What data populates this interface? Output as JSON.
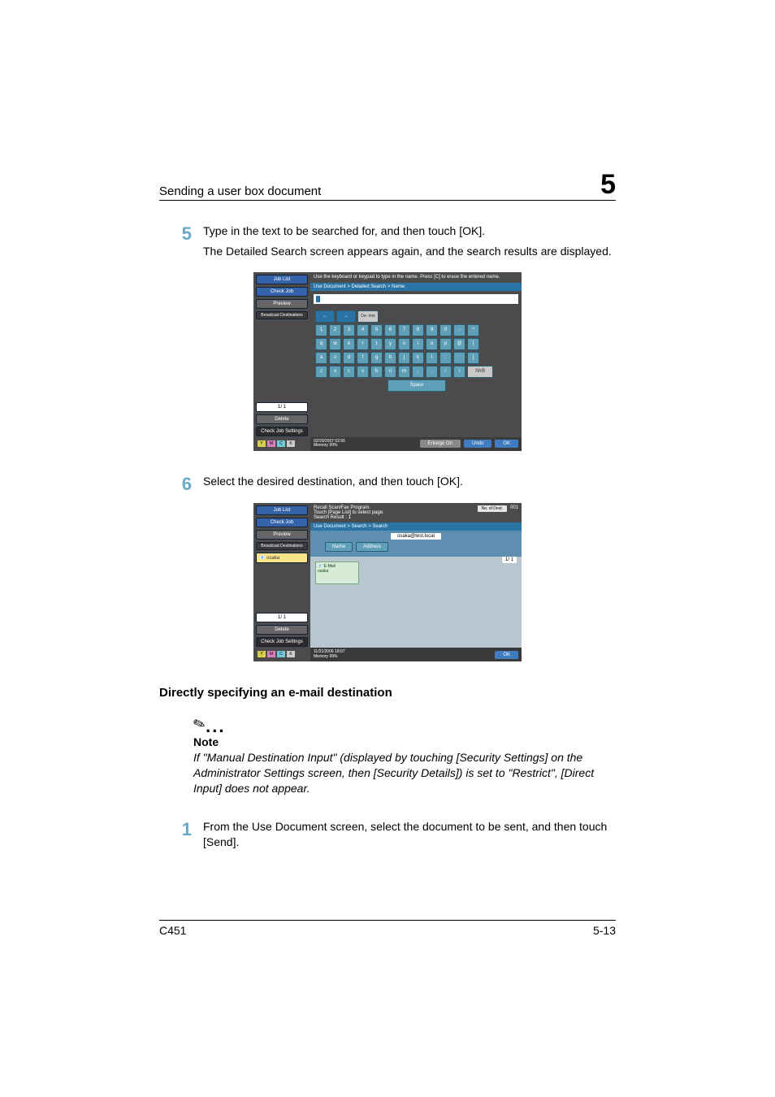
{
  "header": {
    "section_title": "Sending a user box document",
    "chapter_num": "5"
  },
  "step5": {
    "num": "5",
    "line1": "Type in the text to be searched for, and then touch [OK].",
    "line2": "The Detailed Search screen appears again, and the search results are displayed."
  },
  "device1": {
    "sidebar": {
      "job_list": "Job List",
      "check_job": "Check Job",
      "preview": "Preview",
      "broadcast": "Broadcast\nDestinations",
      "page": "1/  1",
      "delete": "Delete",
      "check_settings": "Check Job\nSettings",
      "ind_y": "Y",
      "ind_m": "M",
      "ind_c": "C",
      "ind_k": "K"
    },
    "instruction": "Use the keyboard or keypad to type in the name. Press [C] to erase the entered name.",
    "breadcrumb": "Use Document > Detailed Search > Name",
    "arrows": {
      "left": "←",
      "right": "→",
      "delete": "De-\nlete"
    },
    "row_num": [
      "1",
      "2",
      "3",
      "4",
      "5",
      "6",
      "7",
      "8",
      "9",
      "0",
      "-",
      "^"
    ],
    "row_q": [
      "q",
      "w",
      "e",
      "r",
      "t",
      "y",
      "u",
      "i",
      "o",
      "p",
      "@",
      "["
    ],
    "row_a": [
      "a",
      "s",
      "d",
      "f",
      "g",
      "h",
      "j",
      "k",
      "l",
      ";",
      ":",
      "]"
    ],
    "row_z": [
      "z",
      "x",
      "c",
      "v",
      "b",
      "n",
      "m",
      ",",
      ".",
      "/",
      "\\"
    ],
    "shift": "Shift",
    "space": "Space",
    "footer": {
      "date": "02/20/2007   02:56",
      "mem": "Memory        99%",
      "enlarge": "Enlarge\nOn",
      "undo": "Undo",
      "ok": "OK"
    }
  },
  "step6": {
    "num": "6",
    "text": "Select the desired destination, and then touch [OK]."
  },
  "device2": {
    "sidebar": {
      "job_list": "Job List",
      "check_job": "Check Job",
      "preview": "Preview",
      "broadcast": "Broadcast\nDestinations",
      "item1": "osaka",
      "page": "1/  1",
      "delete": "Delete",
      "check_settings": "Check Job\nSettings"
    },
    "top": {
      "line1": "Recall Scan/Fax Program.",
      "line2": "Touch [Page List] to select page.",
      "line3": "Search Result :     1",
      "dest_label": "No. of\nDest.",
      "dest_count": "001"
    },
    "breadcrumb": "Use Document > Search > Search",
    "address_name": "osaka@test.local",
    "btn_name": "Name",
    "btn_address": "Address",
    "tile_type": "E-Mail",
    "tile_name": "osaka",
    "page_ind": "1/  1",
    "footer": {
      "date": "11/21/2006   18:07",
      "mem": "Memory       99%",
      "ok": "OK"
    }
  },
  "section2": {
    "title": "Directly specifying an e-mail destination"
  },
  "note": {
    "label": "Note",
    "text": "If \"Manual Destination Input\" (displayed by touching [Security Settings] on the Administrator Settings screen, then [Security Details]) is set to \"Restrict\", [Direct Input] does not appear."
  },
  "step1": {
    "num": "1",
    "text": "From the Use Document screen, select the document to be sent, and then touch [Send]."
  },
  "footer": {
    "model": "C451",
    "page": "5-13"
  }
}
